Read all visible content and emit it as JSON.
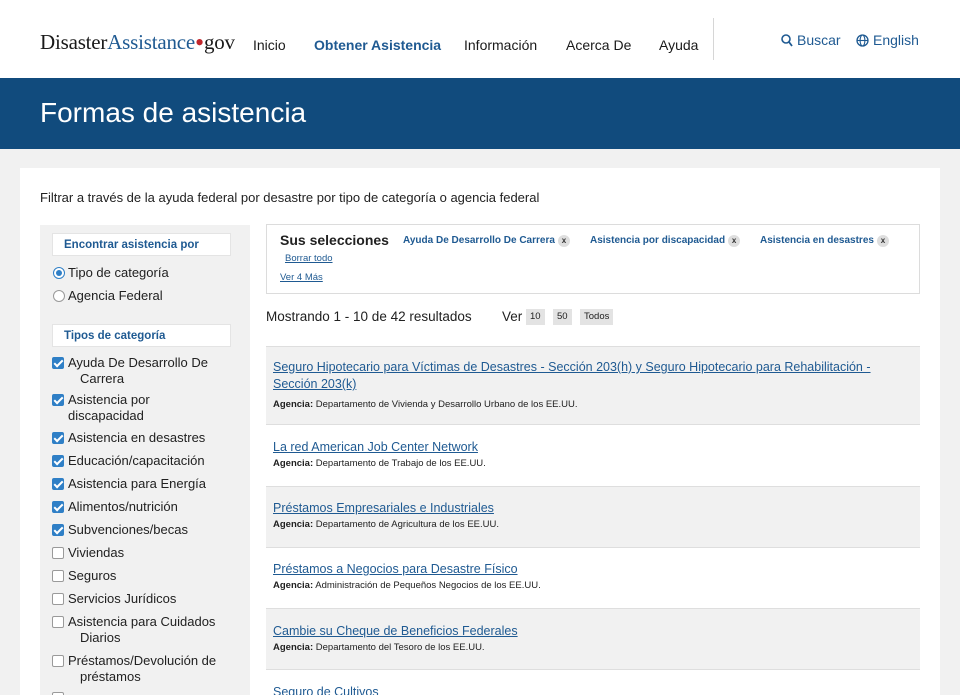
{
  "header": {
    "logo": {
      "part1": "Disaster",
      "part2": "Assistance",
      "dot": "•",
      "part3": "gov"
    },
    "nav": [
      {
        "label": "Inicio"
      },
      {
        "label": "Obtener Asistencia"
      },
      {
        "label": "Información"
      },
      {
        "label": "Acerca De"
      },
      {
        "label": "Ayuda"
      }
    ],
    "search_label": "Buscar",
    "language_label": "English",
    "icons": {
      "search": "search-icon",
      "language": "globe-icon"
    }
  },
  "banner": {
    "title": "Formas de asistencia"
  },
  "intro": "Filtrar a través de la ayuda federal por desastre por tipo de categoría o agencia federal",
  "sidebar": {
    "find_by_heading": "Encontrar asistencia por",
    "find_by_options": [
      {
        "label": "Tipo de categoría",
        "selected": true
      },
      {
        "label": "Agencia Federal",
        "selected": false
      }
    ],
    "category_heading": "Tipos de categoría",
    "categories": [
      {
        "label": "Ayuda De Desarrollo De",
        "label2": "Carrera",
        "checked": true
      },
      {
        "label": "Asistencia por",
        "label2": "discapacidad",
        "checked": true
      },
      {
        "label": "Asistencia en desastres",
        "checked": true
      },
      {
        "label": "Educación/capacitación",
        "checked": true
      },
      {
        "label": "Asistencia para Energía",
        "checked": true
      },
      {
        "label": "Alimentos/nutrición",
        "checked": true
      },
      {
        "label": "Subvenciones/becas",
        "checked": true
      },
      {
        "label": "Viviendas",
        "checked": false
      },
      {
        "label": "Seguros",
        "checked": false
      },
      {
        "label": "Servicios Jurídicos",
        "checked": false
      },
      {
        "label": "Asistencia para Cuidados",
        "label2": "Diarios",
        "checked": false
      },
      {
        "label": "Préstamos/Devolución de",
        "label2": "préstamos",
        "checked": false
      }
    ]
  },
  "selections": {
    "title": "Sus selecciones",
    "chips": [
      {
        "label": "Ayuda De Desarrollo De Carrera",
        "remove": "x"
      },
      {
        "label": "Asistencia por discapacidad",
        "remove": "x"
      },
      {
        "label": "Asistencia en desastres",
        "remove": "x"
      }
    ],
    "clear_all": "Borrar todo",
    "see_more": "Ver 4 Más"
  },
  "results": {
    "showing": "Mostrando 1 - 10 de 42 resultados",
    "view_label": "Ver",
    "page_sizes": [
      "10",
      "50",
      "Todos"
    ],
    "agency_label": "Agencia:",
    "items": [
      {
        "title": "Seguro Hipotecario para Víctimas de Desastres - Sección 203(h) y Seguro Hipotecario para Rehabilitación - Sección 203(k)",
        "agency": "Departamento de Vivienda y Desarrollo Urbano de los EE.UU."
      },
      {
        "title": "La red American Job Center Network",
        "agency": "Departamento de Trabajo de los EE.UU."
      },
      {
        "title": "Préstamos Empresariales e Industriales",
        "agency": "Departamento de Agricultura de los EE.UU."
      },
      {
        "title": "Préstamos a Negocios para Desastre Físico",
        "agency": "Administración de Pequeños Negocios de los EE.UU."
      },
      {
        "title": "Cambie su Cheque de Beneficios Federales",
        "agency": "Departamento del Tesoro de los EE.UU."
      },
      {
        "title": "Seguro de Cultivos",
        "agency": ""
      }
    ]
  }
}
